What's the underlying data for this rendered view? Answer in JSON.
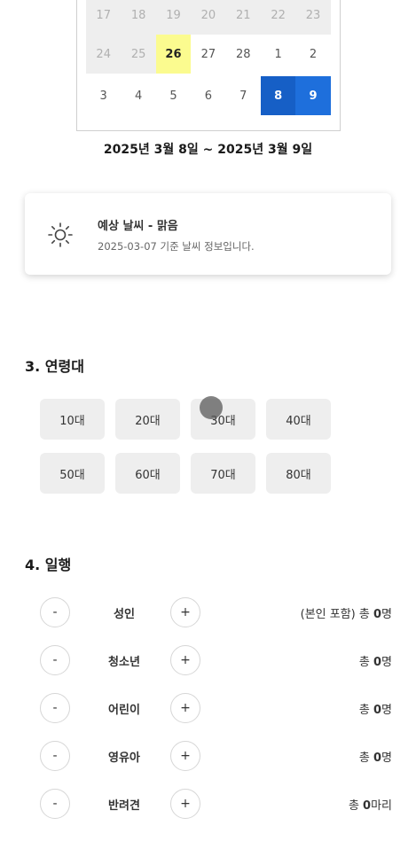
{
  "calendar": {
    "rows": [
      [
        {
          "d": "17",
          "s": "past"
        },
        {
          "d": "18",
          "s": "past"
        },
        {
          "d": "19",
          "s": "past"
        },
        {
          "d": "20",
          "s": "past"
        },
        {
          "d": "21",
          "s": "past"
        },
        {
          "d": "22",
          "s": "past"
        },
        {
          "d": "23",
          "s": "past"
        }
      ],
      [
        {
          "d": "24",
          "s": "past"
        },
        {
          "d": "25",
          "s": "past"
        },
        {
          "d": "26",
          "s": "today"
        },
        {
          "d": "27",
          "s": "normal"
        },
        {
          "d": "28",
          "s": "normal"
        },
        {
          "d": "1",
          "s": "normal"
        },
        {
          "d": "2",
          "s": "normal"
        }
      ],
      [
        {
          "d": "3",
          "s": "normal"
        },
        {
          "d": "4",
          "s": "normal"
        },
        {
          "d": "5",
          "s": "normal"
        },
        {
          "d": "6",
          "s": "normal"
        },
        {
          "d": "7",
          "s": "normal"
        },
        {
          "d": "8",
          "s": "selected start"
        },
        {
          "d": "9",
          "s": "selected"
        }
      ]
    ]
  },
  "date_range": "2025년 3월 8일 ~ 2025년 3월 9일",
  "weather": {
    "icon": "sun-icon",
    "title": "예상 날씨 - 맑음",
    "subtitle": "2025-03-07 기준 날씨 정보입니다."
  },
  "age_section": {
    "title": "3. 연령대",
    "options": [
      "10대",
      "20대",
      "30대",
      "40대",
      "50대",
      "60대",
      "70대",
      "80대"
    ]
  },
  "party_section": {
    "title": "4. 일행",
    "minus_label": "-",
    "plus_label": "+",
    "rows": [
      {
        "label": "성인",
        "prefix": "(본인 포함) 총 ",
        "count": "0",
        "unit": "명"
      },
      {
        "label": "청소년",
        "prefix": "총 ",
        "count": "0",
        "unit": "명"
      },
      {
        "label": "어린이",
        "prefix": "총 ",
        "count": "0",
        "unit": "명"
      },
      {
        "label": "영유아",
        "prefix": "총 ",
        "count": "0",
        "unit": "명"
      },
      {
        "label": "반려견",
        "prefix": "총 ",
        "count": "0",
        "unit": "마리"
      }
    ]
  }
}
